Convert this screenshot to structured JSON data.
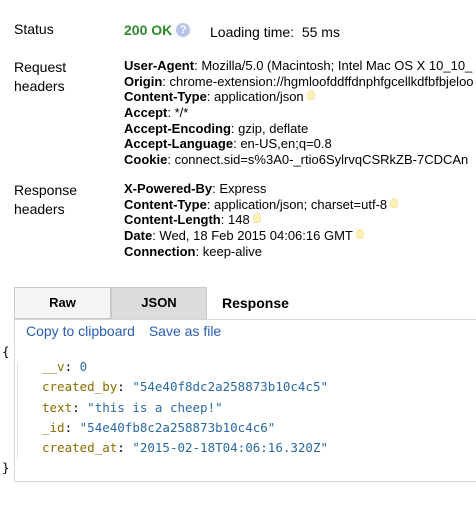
{
  "status": {
    "label": "Status",
    "code": "200 OK",
    "help_icon": "question-icon",
    "loading_label": "Loading time:",
    "loading_value": "55 ms"
  },
  "request_headers": {
    "label": "Request headers",
    "items": [
      {
        "key": "User-Agent",
        "value": "Mozilla/5.0 (Macintosh; Intel Mac OS X 10_10_",
        "hint": false
      },
      {
        "key": "Origin",
        "value": "chrome-extension://hgmloofddffdnphfgcellkdfbfbjeloo",
        "hint": false
      },
      {
        "key": "Content-Type",
        "value": "application/json",
        "hint": true
      },
      {
        "key": "Accept",
        "value": "*/*",
        "hint": false
      },
      {
        "key": "Accept-Encoding",
        "value": "gzip, deflate",
        "hint": false
      },
      {
        "key": "Accept-Language",
        "value": "en-US,en;q=0.8",
        "hint": false
      },
      {
        "key": "Cookie",
        "value": "connect.sid=s%3A0-_rtio6SylrvqCSRkZB-7CDCAn",
        "hint": false
      }
    ]
  },
  "response_headers": {
    "label": "Response headers",
    "items": [
      {
        "key": "X-Powered-By",
        "value": "Express",
        "hint": false
      },
      {
        "key": "Content-Type",
        "value": "application/json; charset=utf-8",
        "hint": true
      },
      {
        "key": "Content-Length",
        "value": "148",
        "hint": true
      },
      {
        "key": "Date",
        "value": "Wed, 18 Feb 2015 04:06:16 GMT",
        "hint": true
      },
      {
        "key": "Connection",
        "value": "keep-alive",
        "hint": false
      }
    ]
  },
  "tabs": {
    "raw": "Raw",
    "json": "JSON",
    "active": "JSON",
    "heading": "Response"
  },
  "actions": {
    "copy": "Copy to clipboard",
    "save": "Save as file"
  },
  "json_body": {
    "open_brace": "{",
    "close_brace": "}",
    "fields": [
      {
        "key": "__v",
        "value": "0"
      },
      {
        "key": "created_by",
        "value": "\"54e40f8dc2a258873b10c4c5\""
      },
      {
        "key": "text",
        "value": "\"this is a cheep!\""
      },
      {
        "key": "_id",
        "value": "\"54e40fb8c2a258873b10c4c6\""
      },
      {
        "key": "created_at",
        "value": "\"2015-02-18T04:06:16.320Z\""
      }
    ]
  },
  "colors": {
    "status_ok": "#2e8a2e",
    "link": "#2a5db0",
    "json_key": "#8a6d00",
    "json_value": "#2a6aa3"
  }
}
